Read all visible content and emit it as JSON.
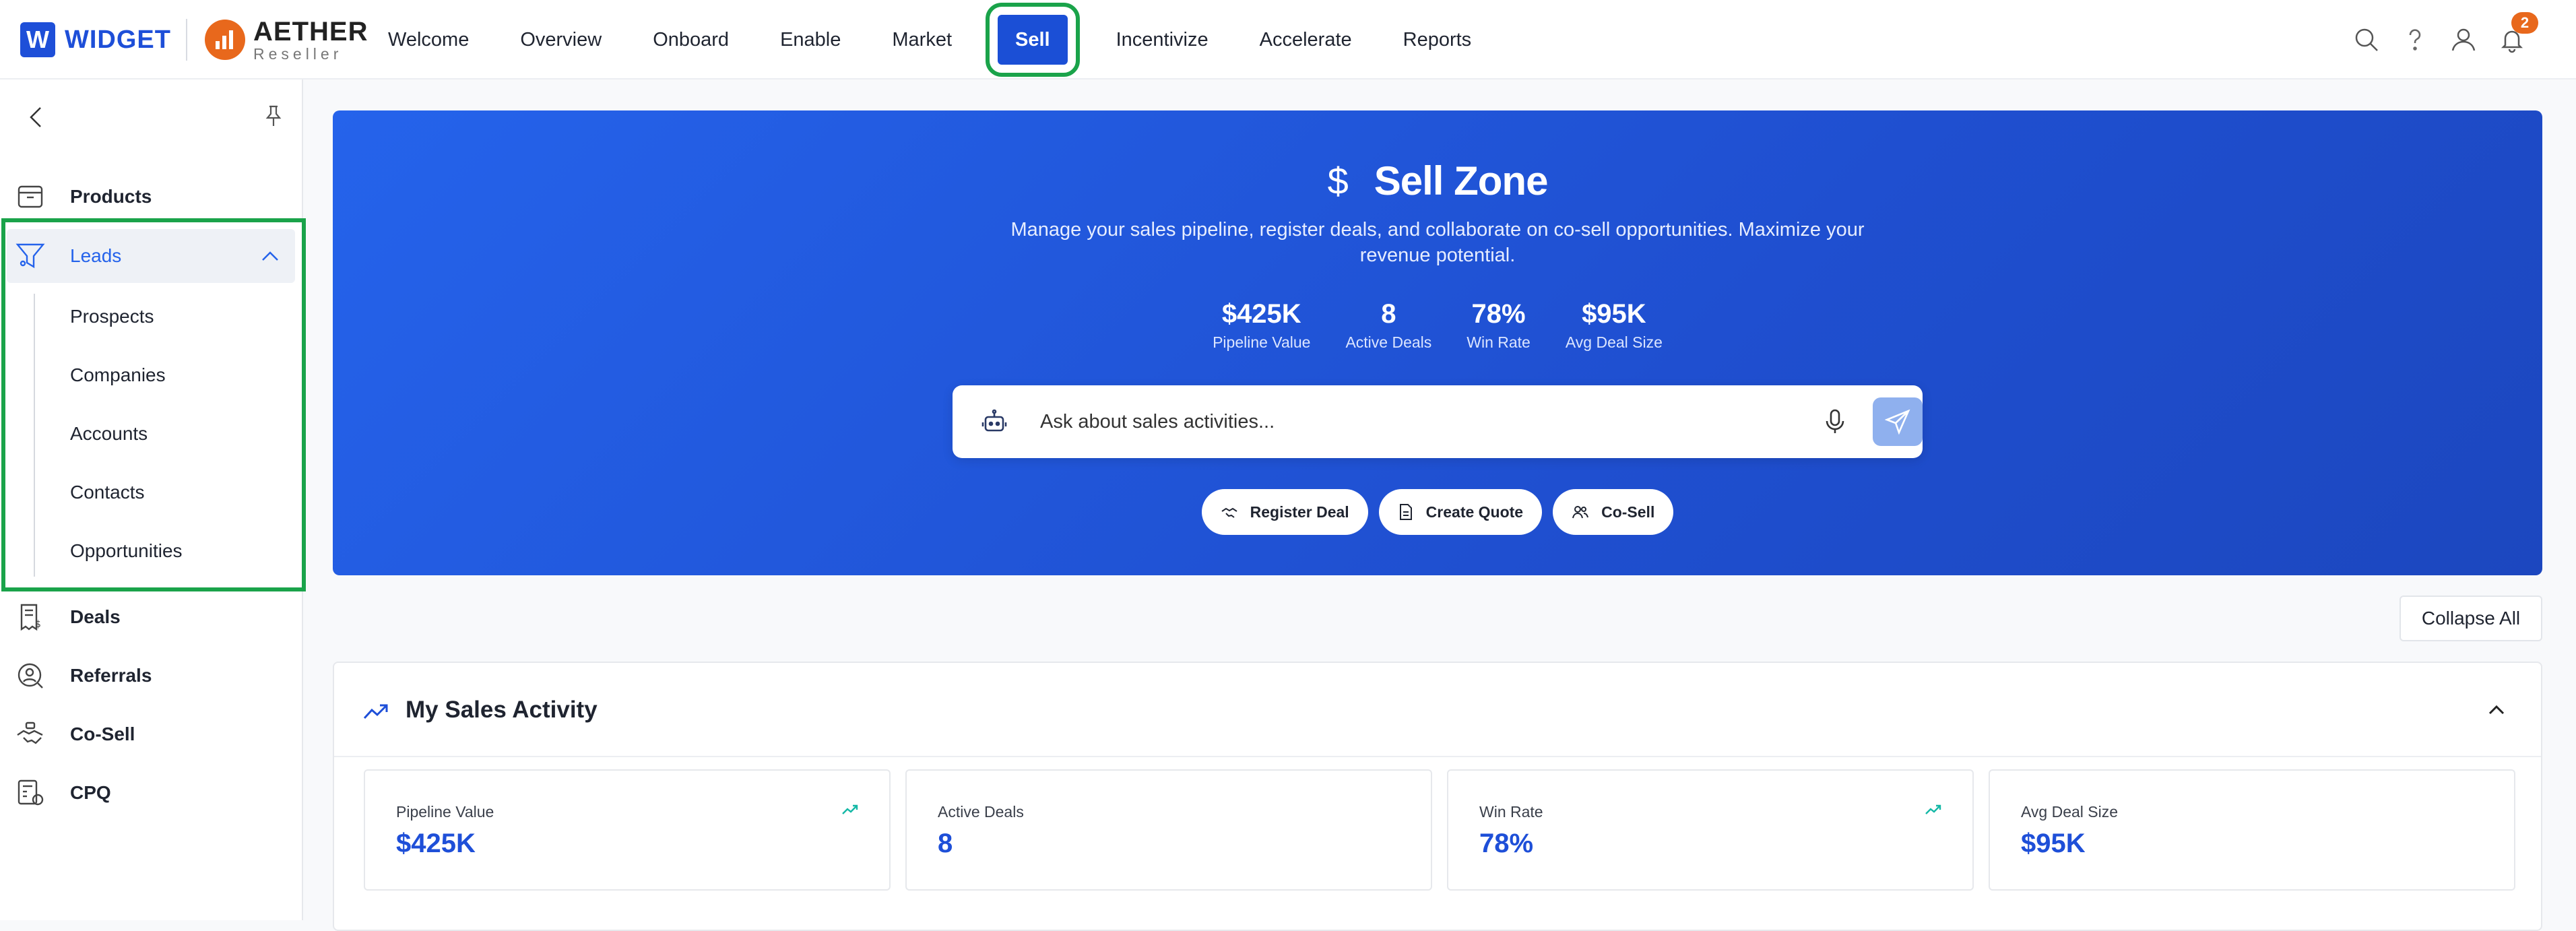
{
  "brand": {
    "widget_letter": "W",
    "widget_name": "WIDGET",
    "aether_name": "AETHER",
    "aether_sub": "Reseller"
  },
  "nav": {
    "items": [
      "Welcome",
      "Overview",
      "Onboard",
      "Enable",
      "Market",
      "Sell",
      "Incentivize",
      "Accelerate",
      "Reports"
    ],
    "active": "Sell"
  },
  "top_icons": {
    "search": "search-icon",
    "help": "help-icon",
    "user": "user-icon",
    "bell": "bell-icon",
    "notifications_count": "2"
  },
  "sidebar": {
    "products": "Products",
    "leads": "Leads",
    "leads_children": [
      "Prospects",
      "Companies",
      "Accounts",
      "Contacts",
      "Opportunities"
    ],
    "deals": "Deals",
    "referrals": "Referrals",
    "cosell": "Co-Sell",
    "cpq": "CPQ"
  },
  "hero": {
    "title": "Sell Zone",
    "description": "Manage your sales pipeline, register deals, and collaborate on co-sell opportunities. Maximize your revenue potential.",
    "stats": [
      {
        "value": "$425K",
        "label": "Pipeline Value"
      },
      {
        "value": "8",
        "label": "Active Deals"
      },
      {
        "value": "78%",
        "label": "Win Rate"
      },
      {
        "value": "$95K",
        "label": "Avg Deal Size"
      }
    ],
    "ask_placeholder": "Ask about sales activities...",
    "quick_actions": [
      "Register Deal",
      "Create Quote",
      "Co-Sell"
    ]
  },
  "controls": {
    "collapse_all": "Collapse All"
  },
  "activity": {
    "title": "My Sales Activity",
    "metrics": [
      {
        "label": "Pipeline Value",
        "value": "$425K",
        "trend": true
      },
      {
        "label": "Active Deals",
        "value": "8",
        "trend": false
      },
      {
        "label": "Win Rate",
        "value": "78%",
        "trend": true
      },
      {
        "label": "Avg Deal Size",
        "value": "$95K",
        "trend": false
      }
    ]
  },
  "colors": {
    "primary": "#1e4fd8",
    "accent_orange": "#e8681c",
    "highlight_green": "#1aa34a",
    "trend_teal": "#14b8a6"
  }
}
